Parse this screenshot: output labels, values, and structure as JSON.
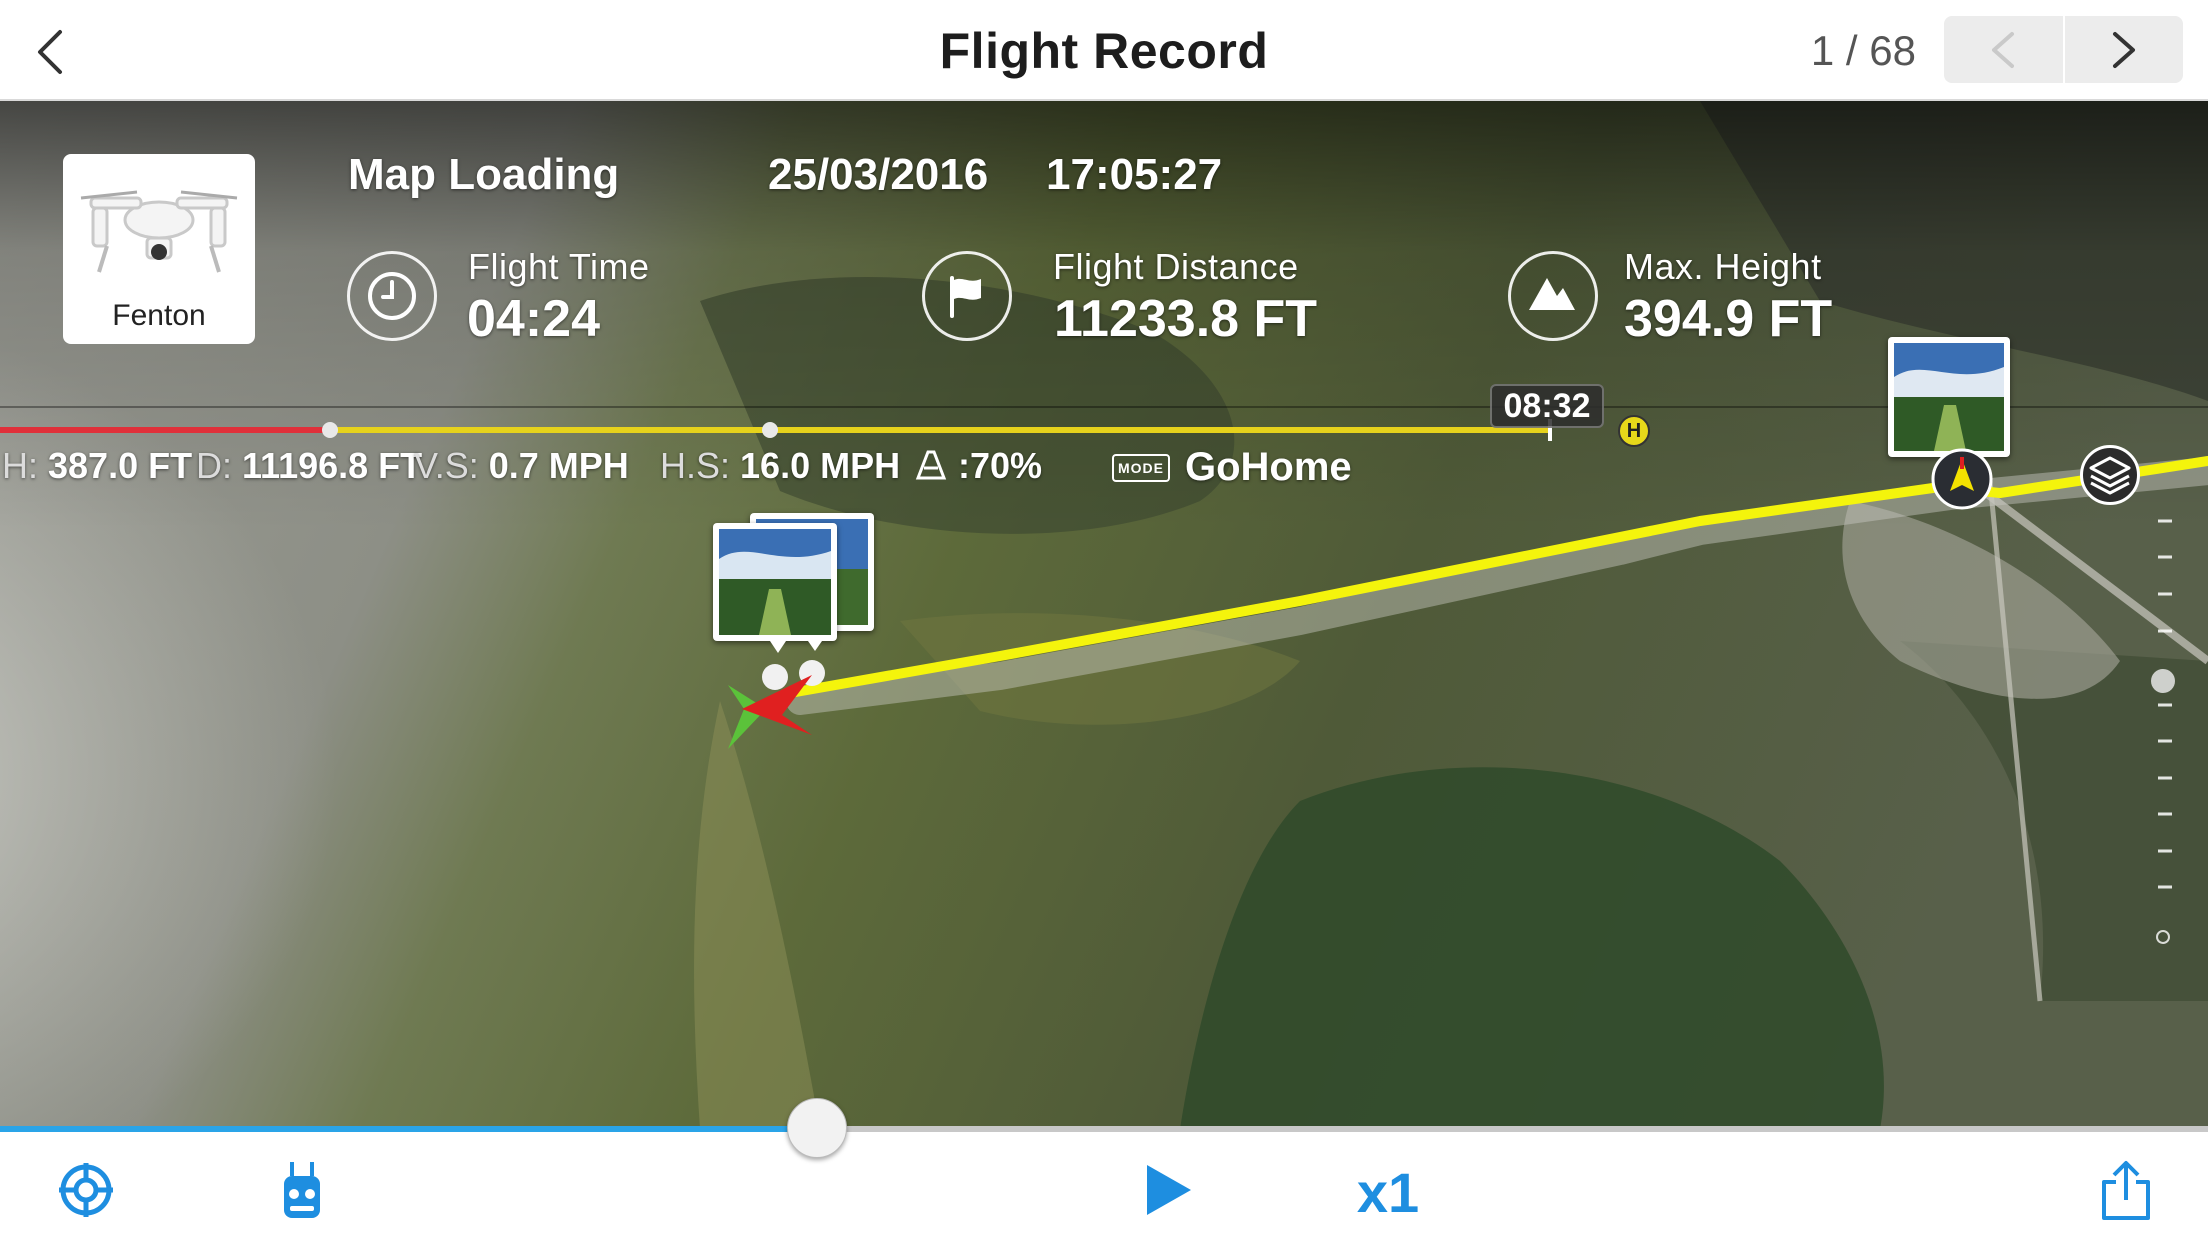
{
  "header": {
    "title": "Flight Record",
    "counter": "1 / 68"
  },
  "drone": {
    "name": "Fenton"
  },
  "record": {
    "location": "Map Loading",
    "date": "25/03/2016",
    "time": "17:05:27"
  },
  "stats": {
    "flight_time_label": "Flight Time",
    "flight_time_value": "04:24",
    "flight_distance_label": "Flight Distance",
    "flight_distance_value": "11233.8 FT",
    "max_height_label": "Max. Height",
    "max_height_value": "394.9 FT"
  },
  "timeline": {
    "end_label": "08:32",
    "home_marker": "H"
  },
  "telemetry": {
    "h_key": "H:",
    "h_val": "387.0 FT",
    "d_key": "D:",
    "d_val": "11196.8 FT",
    "vs_key": "V.S:",
    "vs_val": "0.7 MPH",
    "hs_key": "H.S:",
    "hs_val": "16.0 MPH",
    "battery_val": ":70%",
    "mode_badge": "MODE",
    "mode_val": "GoHome"
  },
  "playback": {
    "progress": 0.37,
    "speed": "x1"
  },
  "colors": {
    "accent": "#2aa4e8",
    "flight_path": "#f4f40c",
    "timeline_red": "#e0303a",
    "timeline_yellow": "#e6d21c"
  }
}
